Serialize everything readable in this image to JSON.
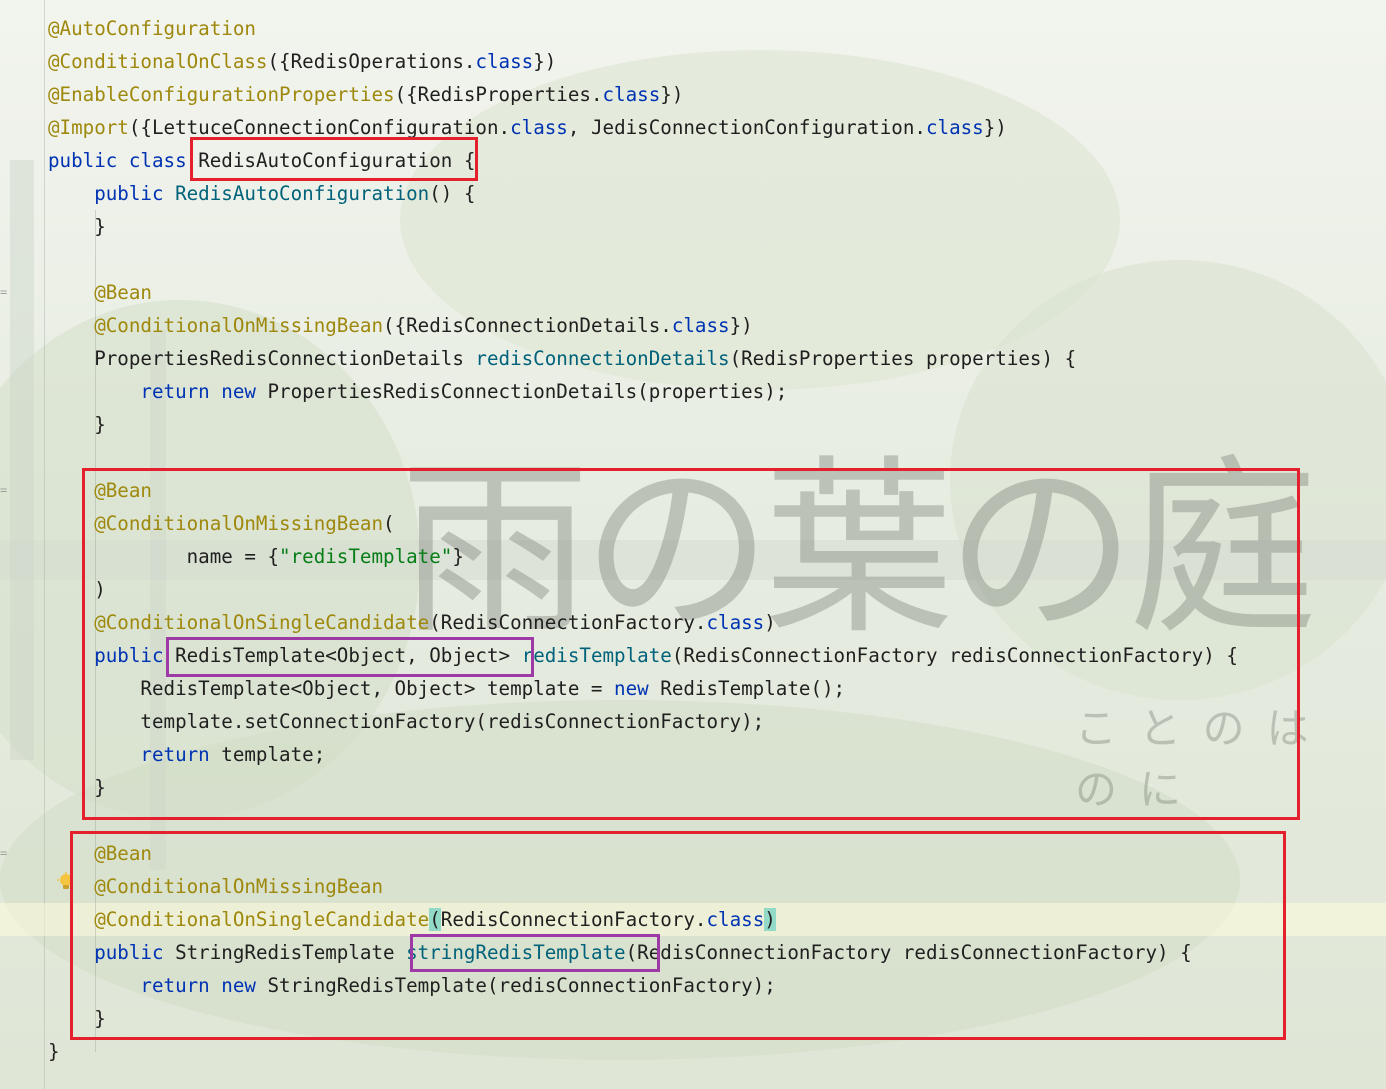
{
  "editor": {
    "lines": [
      [
        {
          "t": "@AutoConfiguration",
          "c": "ann"
        }
      ],
      [
        {
          "t": "@ConditionalOnClass",
          "c": "ann"
        },
        {
          "t": "({RedisOperations.",
          "c": "plain"
        },
        {
          "t": "class",
          "c": "kw"
        },
        {
          "t": "})",
          "c": "plain"
        }
      ],
      [
        {
          "t": "@EnableConfigurationProperties",
          "c": "ann"
        },
        {
          "t": "({RedisProperties.",
          "c": "plain"
        },
        {
          "t": "class",
          "c": "kw"
        },
        {
          "t": "})",
          "c": "plain"
        }
      ],
      [
        {
          "t": "@Import",
          "c": "ann"
        },
        {
          "t": "({LettuceConnectionConfiguration.",
          "c": "plain"
        },
        {
          "t": "class",
          "c": "kw"
        },
        {
          "t": ", JedisConnectionConfiguration.",
          "c": "plain"
        },
        {
          "t": "class",
          "c": "kw"
        },
        {
          "t": "})",
          "c": "plain"
        }
      ],
      [
        {
          "t": "public class ",
          "c": "kw"
        },
        {
          "t": "RedisAutoConfiguration {",
          "c": "plain"
        }
      ],
      [
        {
          "t": "    public ",
          "c": "kw"
        },
        {
          "t": "RedisAutoConfiguration",
          "c": "fn"
        },
        {
          "t": "() {",
          "c": "plain"
        }
      ],
      [
        {
          "t": "    }",
          "c": "plain"
        }
      ],
      [
        {
          "t": "",
          "c": "plain"
        }
      ],
      [
        {
          "t": "    @Bean",
          "c": "ann"
        }
      ],
      [
        {
          "t": "    @ConditionalOnMissingBean",
          "c": "ann"
        },
        {
          "t": "({RedisConnectionDetails.",
          "c": "plain"
        },
        {
          "t": "class",
          "c": "kw"
        },
        {
          "t": "})",
          "c": "plain"
        }
      ],
      [
        {
          "t": "    PropertiesRedisConnectionDetails ",
          "c": "plain"
        },
        {
          "t": "redisConnectionDetails",
          "c": "fn"
        },
        {
          "t": "(RedisProperties properties) {",
          "c": "plain"
        }
      ],
      [
        {
          "t": "        return new ",
          "c": "kw"
        },
        {
          "t": "PropertiesRedisConnectionDetails(properties);",
          "c": "plain"
        }
      ],
      [
        {
          "t": "    }",
          "c": "plain"
        }
      ],
      [
        {
          "t": "",
          "c": "plain"
        }
      ],
      [
        {
          "t": "    @Bean",
          "c": "ann"
        }
      ],
      [
        {
          "t": "    @ConditionalOnMissingBean",
          "c": "ann"
        },
        {
          "t": "(",
          "c": "plain"
        }
      ],
      [
        {
          "t": "            name = {",
          "c": "plain"
        },
        {
          "t": "\"redisTemplate\"",
          "c": "str"
        },
        {
          "t": "}",
          "c": "plain"
        }
      ],
      [
        {
          "t": "    )",
          "c": "plain"
        }
      ],
      [
        {
          "t": "    @ConditionalOnSingleCandidate",
          "c": "ann"
        },
        {
          "t": "(RedisConnectionFactory.",
          "c": "plain"
        },
        {
          "t": "class",
          "c": "kw"
        },
        {
          "t": ")",
          "c": "plain"
        }
      ],
      [
        {
          "t": "    public ",
          "c": "kw"
        },
        {
          "t": "RedisTemplate<Object, Object> ",
          "c": "plain"
        },
        {
          "t": "redisTemplate",
          "c": "fn"
        },
        {
          "t": "(RedisConnectionFactory redisConnectionFactory) {",
          "c": "plain"
        }
      ],
      [
        {
          "t": "        RedisTemplate<Object, Object> template = ",
          "c": "plain"
        },
        {
          "t": "new ",
          "c": "kw"
        },
        {
          "t": "RedisTemplate();",
          "c": "plain"
        }
      ],
      [
        {
          "t": "        template.setConnectionFactory(redisConnectionFactory);",
          "c": "plain"
        }
      ],
      [
        {
          "t": "        return ",
          "c": "kw"
        },
        {
          "t": "template;",
          "c": "plain"
        }
      ],
      [
        {
          "t": "    }",
          "c": "plain"
        }
      ],
      [
        {
          "t": "",
          "c": "plain"
        }
      ],
      [
        {
          "t": "    @Bean",
          "c": "ann"
        }
      ],
      [
        {
          "t": "    @ConditionalOnMissingBean",
          "c": "ann"
        }
      ],
      [
        {
          "t": "    @ConditionalOnSingleCandidate",
          "c": "ann"
        },
        {
          "t": "(",
          "c": "plain",
          "m": true
        },
        {
          "t": "RedisConnectionFactory.",
          "c": "plain"
        },
        {
          "t": "class",
          "c": "kw"
        },
        {
          "t": ")",
          "c": "plain",
          "m": true
        }
      ],
      [
        {
          "t": "    public ",
          "c": "kw"
        },
        {
          "t": "StringRedisTemplate ",
          "c": "plain"
        },
        {
          "t": "stringRedisTemplate",
          "c": "fn"
        },
        {
          "t": "(RedisConnectionFactory redisConnectionFactory) {",
          "c": "plain"
        }
      ],
      [
        {
          "t": "        return new ",
          "c": "kw"
        },
        {
          "t": "StringRedisTemplate(redisConnectionFactory);",
          "c": "plain"
        }
      ],
      [
        {
          "t": "    }",
          "c": "plain"
        }
      ],
      [
        {
          "t": "}",
          "c": "plain"
        }
      ]
    ]
  },
  "background_text": {
    "title": "雨の葉の庭",
    "subtitle": "ことのはのに"
  },
  "icons": {
    "intention": "lightbulb-icon"
  },
  "colors": {
    "annotation": "#9e880d",
    "keyword": "#0033b3",
    "string": "#067d17",
    "method": "#00627a",
    "red_box": "#e3202c",
    "purple_box": "#9d3aa6"
  }
}
